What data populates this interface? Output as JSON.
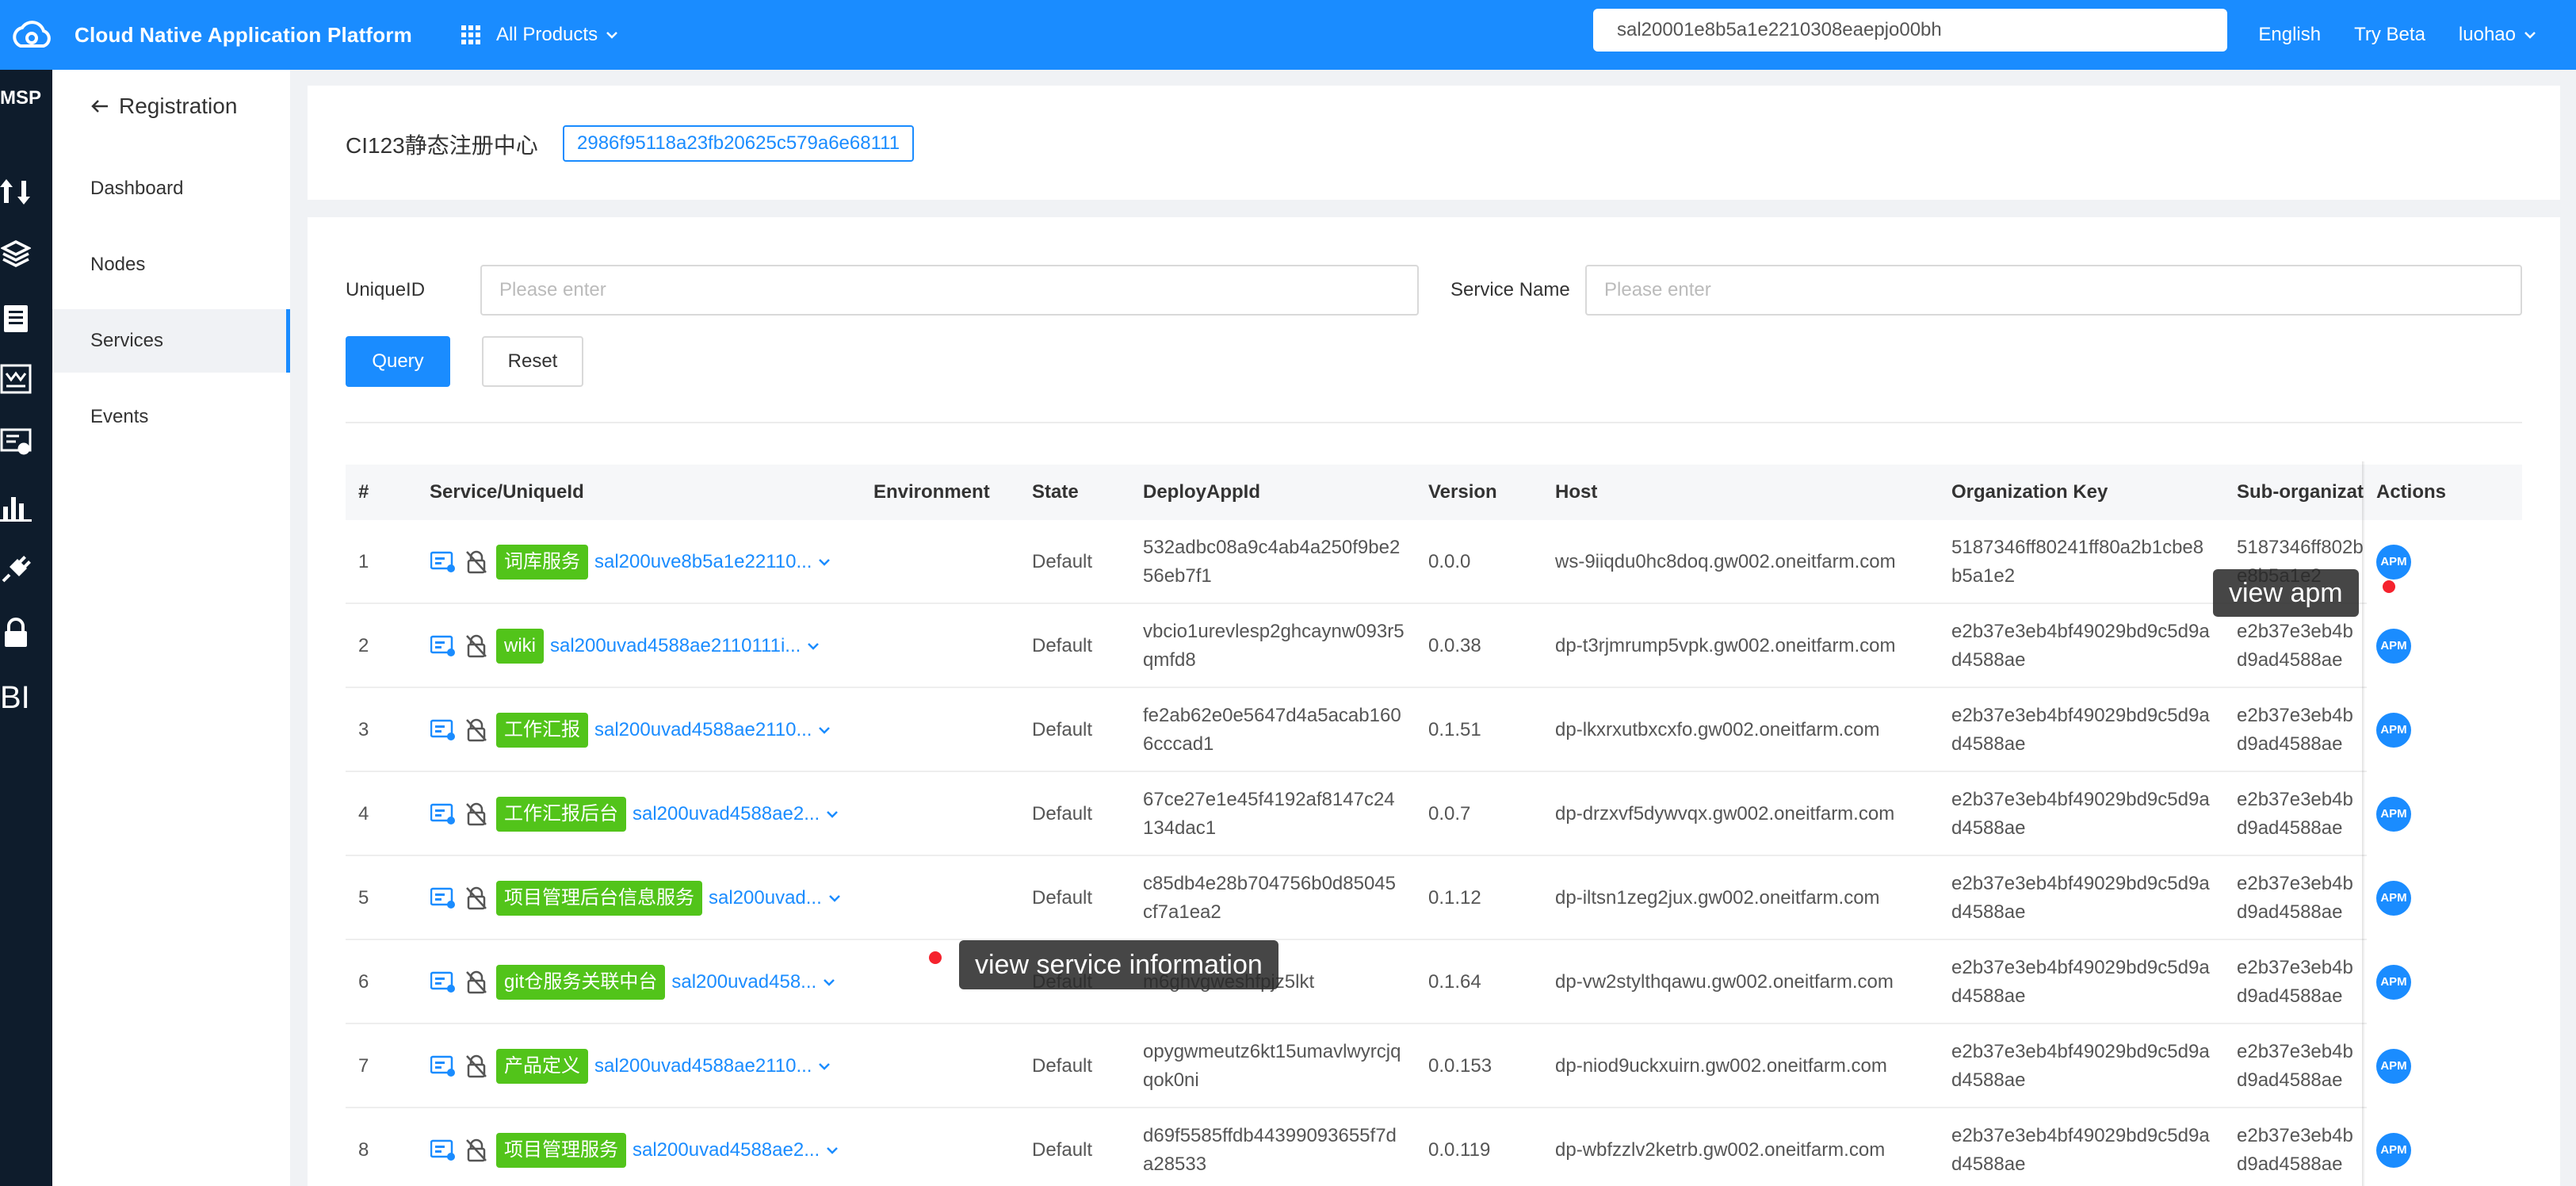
{
  "topbar": {
    "app_title": "Cloud Native Application Platform",
    "all_products": "All Products",
    "search_value": "sal20001e8b5a1e2210308eaepjo00bh",
    "language": "English",
    "try_beta": "Try Beta",
    "user": "luohao",
    "bg_color": "#1a8cff"
  },
  "rail": {
    "title": "MSP",
    "bottom_label": "BI",
    "icons": [
      "traffic-icon",
      "layers-icon",
      "clipboard-icon",
      "dashboard-icon",
      "certificate-icon",
      "bar-chart-icon",
      "plug-icon",
      "lock-icon"
    ]
  },
  "subnav": {
    "back_label": "Registration",
    "items": [
      {
        "label": "Dashboard"
      },
      {
        "label": "Nodes"
      },
      {
        "label": "Services",
        "active": true
      },
      {
        "label": "Events"
      }
    ]
  },
  "registry": {
    "name": "CI123静态注册中心",
    "id": "2986f95118a23fb20625c579a6e68111"
  },
  "filters": {
    "unique_id_label": "UniqueID",
    "unique_id_placeholder": "Please enter",
    "service_name_label": "Service Name",
    "service_name_placeholder": "Please enter",
    "query_label": "Query",
    "reset_label": "Reset"
  },
  "table": {
    "headers": [
      "#",
      "Service/UniqueId",
      "Environment",
      "State",
      "DeployAppId",
      "Version",
      "Host",
      "Organization Key",
      "Sub-organizat",
      "Actions"
    ],
    "rows": [
      {
        "num": "1",
        "tag": "词库服务",
        "uid": "sal200uve8b5a1e22110...",
        "env": "",
        "state": "Default",
        "deploy": "532adbc08a9c4ab4a250f9be256eb7f1",
        "version": "0.0.0",
        "host": "ws-9iiqdu0hc8doq.gw002.oneitfarm.com",
        "org": "5187346ff80241ff80a2b1cbe8b5a1e2",
        "sub": "5187346ff802be8b5a1e2",
        "action": "APM"
      },
      {
        "num": "2",
        "tag": "wiki",
        "uid": "sal200uvad4588ae2110111i...",
        "env": "",
        "state": "Default",
        "deploy": "vbcio1urevlesp2ghcaynw093r5qmfd8",
        "version": "0.0.38",
        "host": "dp-t3rjmrump5vpk.gw002.oneitfarm.com",
        "org": "e2b37e3eb4bf49029bd9c5d9ad4588ae",
        "sub": "e2b37e3eb4bd9ad4588ae",
        "action": "APM"
      },
      {
        "num": "3",
        "tag": "工作汇报",
        "uid": "sal200uvad4588ae2110...",
        "env": "",
        "state": "Default",
        "deploy": "fe2ab62e0e5647d4a5acab1606cccad1",
        "version": "0.1.51",
        "host": "dp-lkxrxutbxcxfo.gw002.oneitfarm.com",
        "org": "e2b37e3eb4bf49029bd9c5d9ad4588ae",
        "sub": "e2b37e3eb4bd9ad4588ae",
        "action": "APM"
      },
      {
        "num": "4",
        "tag": "工作汇报后台",
        "uid": "sal200uvad4588ae2...",
        "env": "",
        "state": "Default",
        "deploy": "67ce27e1e45f4192af8147c24134dac1",
        "version": "0.0.7",
        "host": "dp-drzxvf5dywvqx.gw002.oneitfarm.com",
        "org": "e2b37e3eb4bf49029bd9c5d9ad4588ae",
        "sub": "e2b37e3eb4bd9ad4588ae",
        "action": "APM"
      },
      {
        "num": "5",
        "tag": "项目管理后台信息服务",
        "uid": "sal200uvad...",
        "env": "",
        "state": "Default",
        "deploy": "c85db4e28b704756b0d85045cf7a1ea2",
        "version": "0.1.12",
        "host": "dp-iltsn1zeg2jux.gw002.oneitfarm.com",
        "org": "e2b37e3eb4bf49029bd9c5d9ad4588ae",
        "sub": "e2b37e3eb4bd9ad4588ae",
        "action": "APM"
      },
      {
        "num": "6",
        "tag": "git仓服务关联中台",
        "uid": "sal200uvad458...",
        "env": "",
        "state": "Default",
        "deploy": "m6ghvgweshfpjz5lkt",
        "version": "0.1.64",
        "host": "dp-vw2stylthqawu.gw002.oneitfarm.com",
        "org": "e2b37e3eb4bf49029bd9c5d9ad4588ae",
        "sub": "e2b37e3eb4bd9ad4588ae",
        "action": "APM"
      },
      {
        "num": "7",
        "tag": "产品定义",
        "uid": "sal200uvad4588ae2110...",
        "env": "",
        "state": "Default",
        "deploy": "opygwmeutz6kt15umavlwyrcjqqok0ni",
        "version": "0.0.153",
        "host": "dp-niod9uckxuirn.gw002.oneitfarm.com",
        "org": "e2b37e3eb4bf49029bd9c5d9ad4588ae",
        "sub": "e2b37e3eb4bd9ad4588ae",
        "action": "APM"
      },
      {
        "num": "8",
        "tag": "项目管理服务",
        "uid": "sal200uvad4588ae2...",
        "env": "",
        "state": "Default",
        "deploy": "d69f5585ffdb44399093655f7da28533",
        "version": "0.0.119",
        "host": "dp-wbfzzlv2ketrb.gw002.oneitfarm.com",
        "org": "e2b37e3eb4bf49029bd9c5d9ad4588ae",
        "sub": "e2b37e3eb4bd9ad4588ae",
        "action": "APM"
      }
    ]
  },
  "tooltips": {
    "apm": "view apm",
    "service_info": "view service information"
  },
  "colors": {
    "primary": "#1a8cff",
    "tag_green": "#52c41a",
    "rail_dark": "#0e1c2c",
    "red_dot": "#f5222d"
  }
}
